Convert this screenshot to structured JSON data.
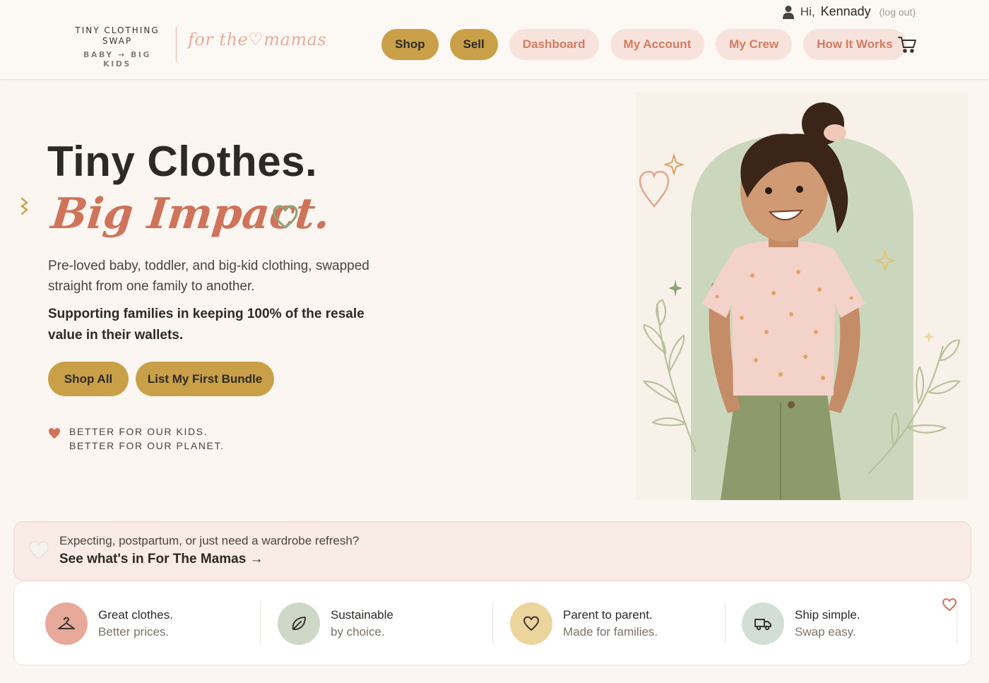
{
  "header": {
    "greeting_prefix": "Hi,",
    "user_name": "Kennady",
    "logout_label": "(log out)",
    "logo": {
      "line1": "TINY CLOTHING",
      "line2": "SWAP",
      "line3": "BABY → BIG KIDS"
    },
    "sub_brand": "for the♡mamas",
    "nav": [
      {
        "label": "Shop",
        "style": "primary"
      },
      {
        "label": "Sell",
        "style": "primary"
      },
      {
        "label": "Dashboard",
        "style": "soft"
      },
      {
        "label": "My Account",
        "style": "soft"
      },
      {
        "label": "My Crew",
        "style": "soft"
      },
      {
        "label": "How It Works",
        "style": "soft"
      }
    ],
    "cart_icon": "cart-icon"
  },
  "hero": {
    "title_line1": "Tiny Clothes.",
    "title_line2": "Big Impact.",
    "subtitle": "Pre-loved baby, toddler, and big-kid clothing, swapped straight from one family to another.",
    "emphasis": "Supporting families in keeping 100% of the resale value in their wallets.",
    "buttons": {
      "shop_all": "Shop All",
      "list_bundle": "List My First Bundle"
    },
    "tagline_line1": "BETTER FOR OUR KIDS.",
    "tagline_line2": "BETTER FOR OUR PLANET."
  },
  "mamas_banner": {
    "question": "Expecting, postpartum, or just need a wardrobe refresh?",
    "link_label": "See what's in For The Mamas →"
  },
  "features": [
    {
      "title": "Great clothes.",
      "subtitle": "Better prices.",
      "icon": "hanger-icon",
      "color": "#e6a99a"
    },
    {
      "title": "Sustainable",
      "subtitle": "by choice.",
      "icon": "leaf-icon",
      "color": "#cdd9c6"
    },
    {
      "title": "Parent to parent.",
      "subtitle": "Made for families.",
      "icon": "heart-icon",
      "color": "#ecd49d"
    },
    {
      "title": "Ship simple.",
      "subtitle": "Swap easy.",
      "icon": "truck-icon",
      "color": "#d3dfd6"
    }
  ],
  "colors": {
    "gold": "#c9a047",
    "coral": "#cf735b",
    "soft_pink": "#f8e3dc",
    "sage": "#cbd7bc",
    "background": "#fbf6f1"
  }
}
